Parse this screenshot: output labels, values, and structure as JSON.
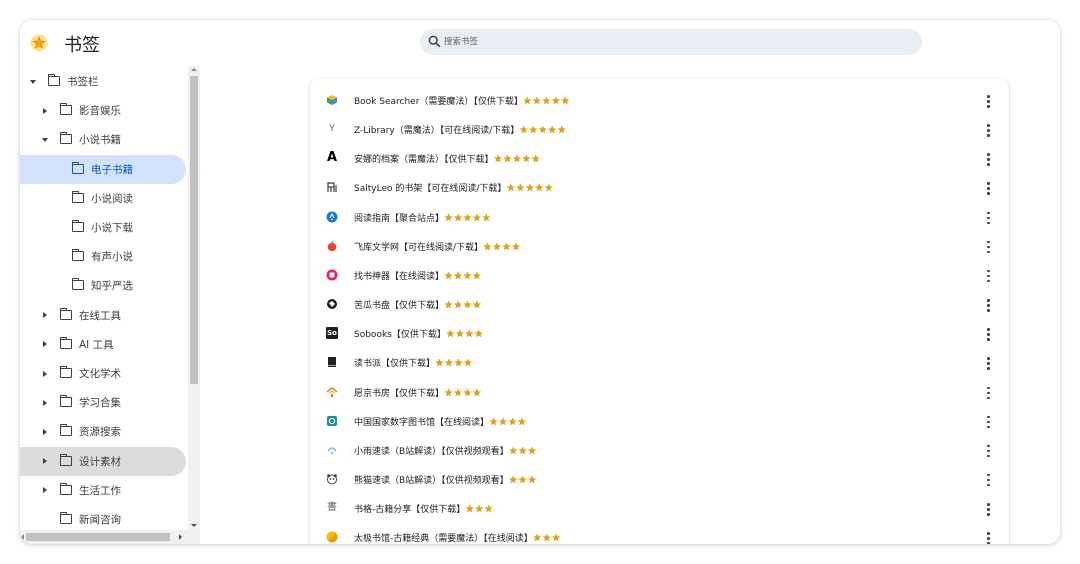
{
  "app": {
    "title": "书签"
  },
  "search": {
    "placeholder": "搜索书签"
  },
  "colors": {
    "selected_bg": "#d3e3fd",
    "selected_text": "#0b57d0",
    "star": "#e8a200",
    "search_bg": "#e8edf6"
  },
  "sidebar": {
    "items": [
      {
        "label": "书签栏",
        "expander": "expanded",
        "icon": "folder-icon"
      },
      {
        "label": "影音娱乐",
        "expander": "collapsed",
        "icon": "folder-icon"
      },
      {
        "label": "小说书籍",
        "expander": "expanded",
        "icon": "folder-icon"
      },
      {
        "label": "电子书籍",
        "expander": "none",
        "icon": "folder-icon",
        "state": "selected"
      },
      {
        "label": "小说阅读",
        "expander": "none",
        "icon": "folder-icon"
      },
      {
        "label": "小说下载",
        "expander": "none",
        "icon": "folder-icon"
      },
      {
        "label": "有声小说",
        "expander": "none",
        "icon": "folder-icon"
      },
      {
        "label": "知乎严选",
        "expander": "none",
        "icon": "folder-icon"
      },
      {
        "label": "在线工具",
        "expander": "collapsed",
        "icon": "folder-icon"
      },
      {
        "label": "AI 工具",
        "expander": "collapsed",
        "icon": "folder-icon"
      },
      {
        "label": "文化学术",
        "expander": "collapsed",
        "icon": "folder-icon"
      },
      {
        "label": "学习合集",
        "expander": "collapsed",
        "icon": "folder-icon"
      },
      {
        "label": "资源搜索",
        "expander": "collapsed",
        "icon": "folder-icon"
      },
      {
        "label": "设计素材",
        "expander": "collapsed",
        "icon": "folder-icon",
        "state": "hover"
      },
      {
        "label": "生活工作",
        "expander": "collapsed",
        "icon": "folder-icon"
      },
      {
        "label": "新闻咨询",
        "expander": "none",
        "icon": "folder-icon"
      }
    ]
  },
  "bookmarks": [
    {
      "title": "Book Searcher（需要魔法）【仅供下载】",
      "stars": "★★★★★",
      "favicon": "cube-icon"
    },
    {
      "title": "Z-Library（需魔法）【可在线阅读/下载】",
      "stars": "★★★★★",
      "favicon": "zlibrary-icon"
    },
    {
      "title": "安娜的档案（需魔法）【仅供下载】",
      "stars": "★★★★★",
      "favicon": "letter-a-icon"
    },
    {
      "title": "SaltyLeo 的书架【可在线阅读/下载】",
      "stars": "★★★★★",
      "favicon": "bookshelf-icon"
    },
    {
      "title": "阅读指南【聚合站点】",
      "stars": "★★★★★",
      "favicon": "blue-circle-icon"
    },
    {
      "title": "飞库文学网【可在线阅读/下载】",
      "stars": "★★★★",
      "favicon": "apple-icon"
    },
    {
      "title": "找书神器【在线阅读】",
      "stars": "★★★★",
      "favicon": "pink-circle-icon"
    },
    {
      "title": "苦瓜书盘【仅供下载】",
      "stars": "★★★★",
      "favicon": "globe-icon"
    },
    {
      "title": "Sobooks【仅供下载】",
      "stars": "★★★★",
      "favicon": "sobooks-icon"
    },
    {
      "title": "读书派【仅供下载】",
      "stars": "★★★★",
      "favicon": "book-icon"
    },
    {
      "title": "愿京书房【仅供下载】",
      "stars": "★★★★",
      "favicon": "house-icon"
    },
    {
      "title": "中国国家数字图书馆【在线阅读】",
      "stars": "★★★★",
      "favicon": "library-icon"
    },
    {
      "title": "小雨速读（B站解读）【仅供视频观看】",
      "stars": "★★★",
      "favicon": "rain-icon"
    },
    {
      "title": "熊猫速读（B站解读）【仅供视频观看】",
      "stars": "★★★",
      "favicon": "panda-icon"
    },
    {
      "title": "书格-古籍分享【仅供下载】",
      "stars": "★★★",
      "favicon": "shuge-icon"
    },
    {
      "title": "太极书馆-古籍经典（需要魔法）【在线阅读】",
      "stars": "★★★",
      "favicon": "taiji-icon"
    }
  ],
  "glyphs": {
    "zlibrary": "Y",
    "letter_a": "A",
    "sobooks": "So",
    "shuge": "書"
  }
}
